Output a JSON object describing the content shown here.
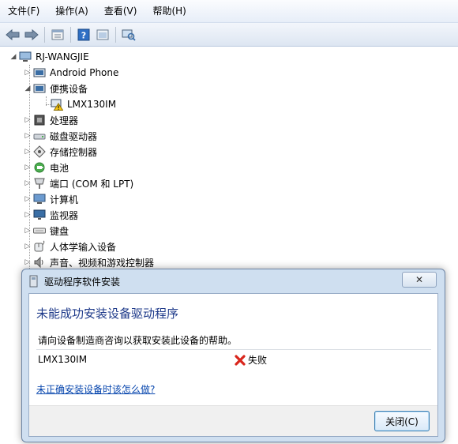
{
  "menu": {
    "items": [
      {
        "label": "文件(F)"
      },
      {
        "label": "操作(A)"
      },
      {
        "label": "查看(V)"
      },
      {
        "label": "帮助(H)"
      }
    ]
  },
  "toolbar": {
    "buttons": [
      "back-icon",
      "forward-icon",
      "properties-icon",
      "help-icon",
      "update-driver-icon",
      "scan-hardware-icon"
    ]
  },
  "tree": {
    "root": "RJ-WANGJIE",
    "nodes": [
      {
        "label": "Android Phone",
        "icon": "device-icon"
      },
      {
        "label": "便携设备",
        "icon": "device-icon",
        "expanded": true
      },
      {
        "label": "LMX130IM",
        "icon": "warning-device-icon",
        "child": true
      },
      {
        "label": "处理器",
        "icon": "cpu-icon"
      },
      {
        "label": "磁盘驱动器",
        "icon": "disk-icon"
      },
      {
        "label": "存储控制器",
        "icon": "storage-icon"
      },
      {
        "label": "电池",
        "icon": "battery-icon"
      },
      {
        "label": "端口 (COM 和 LPT)",
        "icon": "port-icon"
      },
      {
        "label": "计算机",
        "icon": "computer-icon"
      },
      {
        "label": "监视器",
        "icon": "monitor-icon"
      },
      {
        "label": "键盘",
        "icon": "keyboard-icon"
      },
      {
        "label": "人体学输入设备",
        "icon": "hid-icon"
      },
      {
        "label": "声音、视频和游戏控制器",
        "icon": "sound-icon"
      }
    ]
  },
  "dialog": {
    "title": "驱动程序软件安装",
    "close_glyph": "✕",
    "heading": "未能成功安装设备驱动程序",
    "message": "请向设备制造商咨询以获取安装此设备的帮助。",
    "device": "LMX130IM",
    "status": "失败",
    "help_link": "未正确安装设备时该怎么做?",
    "close_button": "关闭(C)"
  },
  "colors": {
    "heading": "#1e3a8a",
    "link": "#0645ad",
    "fail": "#d9261c"
  }
}
